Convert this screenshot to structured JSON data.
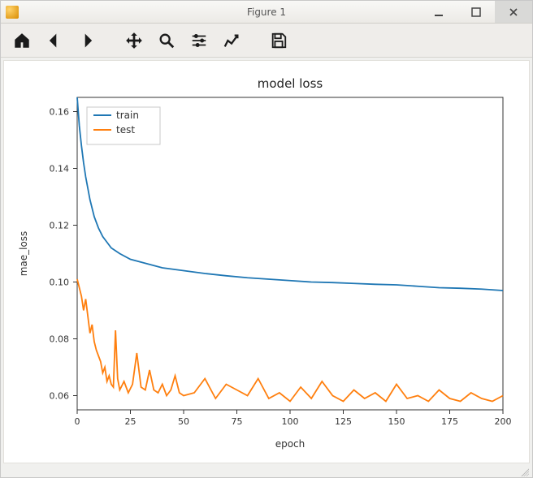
{
  "window": {
    "title": "Figure 1"
  },
  "toolbar": {
    "home": "home-icon",
    "back": "back-icon",
    "forward": "forward-icon",
    "pan": "move-icon",
    "zoom": "zoom-icon",
    "subplots": "sliders-icon",
    "axes": "chart-line-icon",
    "save": "save-icon"
  },
  "chart_data": {
    "type": "line",
    "title": "model loss",
    "xlabel": "epoch",
    "ylabel": "mae_loss",
    "xlim": [
      0,
      200
    ],
    "ylim": [
      0.055,
      0.165
    ],
    "xticks": [
      0,
      25,
      50,
      75,
      100,
      125,
      150,
      175,
      200
    ],
    "yticks": [
      0.06,
      0.08,
      0.1,
      0.12,
      0.14,
      0.16
    ],
    "legend_position": "upper-left",
    "series": [
      {
        "name": "train",
        "color": "#1f77b4",
        "x": [
          0,
          1,
          2,
          3,
          4,
          5,
          6,
          7,
          8,
          9,
          10,
          12,
          14,
          16,
          18,
          20,
          25,
          30,
          35,
          40,
          45,
          50,
          60,
          70,
          80,
          90,
          100,
          110,
          120,
          130,
          140,
          150,
          160,
          170,
          180,
          190,
          200
        ],
        "y": [
          0.165,
          0.155,
          0.148,
          0.142,
          0.137,
          0.133,
          0.129,
          0.126,
          0.123,
          0.121,
          0.119,
          0.116,
          0.114,
          0.112,
          0.111,
          0.11,
          0.108,
          0.107,
          0.106,
          0.105,
          0.1045,
          0.104,
          0.103,
          0.1022,
          0.1015,
          0.101,
          0.1005,
          0.1,
          0.0998,
          0.0995,
          0.0992,
          0.099,
          0.0985,
          0.098,
          0.0978,
          0.0975,
          0.097
        ]
      },
      {
        "name": "test",
        "color": "#ff7f0e",
        "x": [
          0,
          1,
          2,
          3,
          4,
          5,
          6,
          7,
          8,
          9,
          10,
          11,
          12,
          13,
          14,
          15,
          16,
          17,
          18,
          19,
          20,
          22,
          24,
          26,
          28,
          30,
          32,
          34,
          36,
          38,
          40,
          42,
          44,
          46,
          48,
          50,
          55,
          60,
          65,
          70,
          75,
          80,
          85,
          90,
          95,
          100,
          105,
          110,
          115,
          120,
          125,
          130,
          135,
          140,
          145,
          150,
          155,
          160,
          165,
          170,
          175,
          180,
          185,
          190,
          195,
          200
        ],
        "y": [
          0.101,
          0.098,
          0.095,
          0.09,
          0.094,
          0.088,
          0.082,
          0.085,
          0.079,
          0.076,
          0.074,
          0.072,
          0.068,
          0.07,
          0.065,
          0.067,
          0.064,
          0.063,
          0.083,
          0.066,
          0.062,
          0.065,
          0.061,
          0.064,
          0.075,
          0.063,
          0.062,
          0.069,
          0.062,
          0.061,
          0.064,
          0.06,
          0.062,
          0.067,
          0.061,
          0.06,
          0.061,
          0.066,
          0.059,
          0.064,
          0.062,
          0.06,
          0.066,
          0.059,
          0.061,
          0.058,
          0.063,
          0.059,
          0.065,
          0.06,
          0.058,
          0.062,
          0.059,
          0.061,
          0.058,
          0.064,
          0.059,
          0.06,
          0.058,
          0.062,
          0.059,
          0.058,
          0.061,
          0.059,
          0.058,
          0.06
        ]
      }
    ]
  }
}
